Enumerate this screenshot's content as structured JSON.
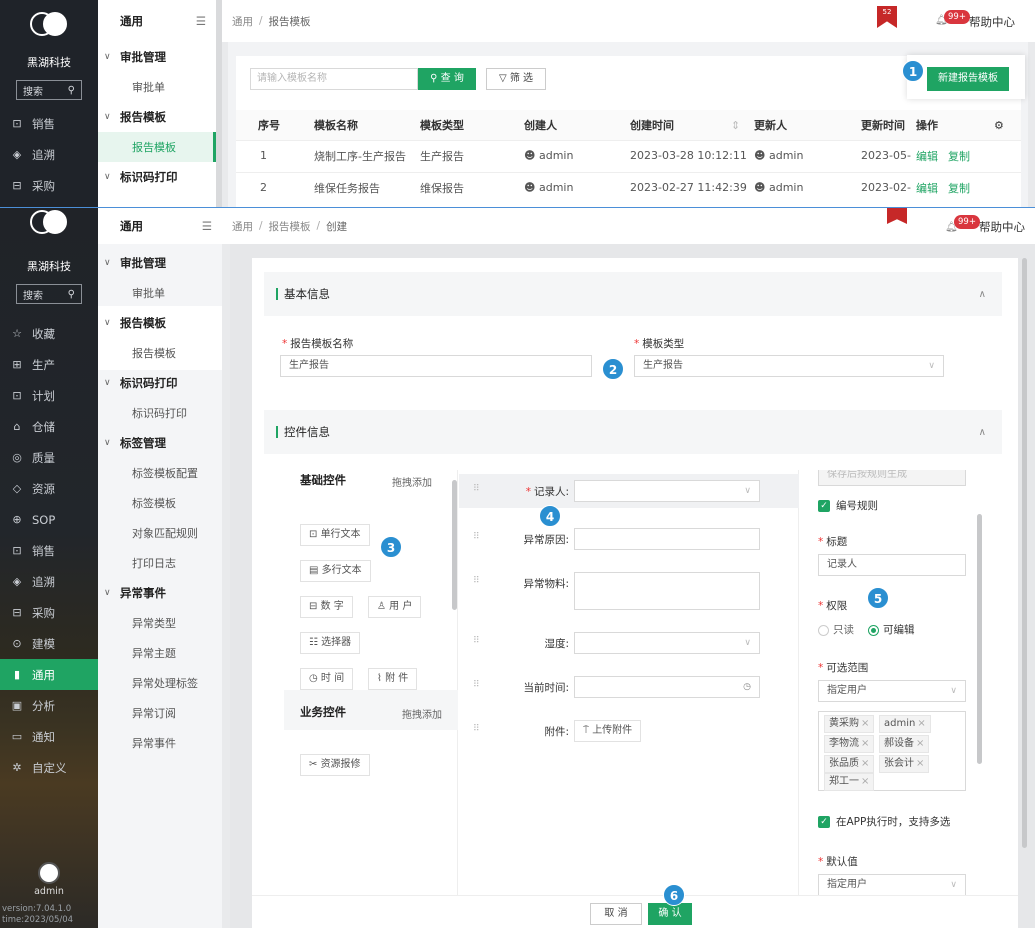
{
  "brand": "黑湖科技",
  "side_search": "搜索",
  "nav_top": [
    {
      "icon": "wallet-icon",
      "glyph": "⊡",
      "label": "销售"
    },
    {
      "icon": "trace-icon",
      "glyph": "◈",
      "label": "追溯"
    },
    {
      "icon": "purchase-icon",
      "glyph": "⊟",
      "label": "采购"
    }
  ],
  "nav_bottom": [
    {
      "icon": "star-icon",
      "glyph": "☆",
      "label": "收藏"
    },
    {
      "icon": "factory-icon",
      "glyph": "⊞",
      "label": "生产"
    },
    {
      "icon": "calendar-icon",
      "glyph": "⊡",
      "label": "计划"
    },
    {
      "icon": "warehouse-icon",
      "glyph": "⌂",
      "label": "仓储"
    },
    {
      "icon": "quality-icon",
      "glyph": "◎",
      "label": "质量"
    },
    {
      "icon": "resource-icon",
      "glyph": "◇",
      "label": "资源"
    },
    {
      "icon": "sop-icon",
      "glyph": "⊕",
      "label": "SOP"
    },
    {
      "icon": "wallet-icon",
      "glyph": "⊡",
      "label": "销售"
    },
    {
      "icon": "trace-icon",
      "glyph": "◈",
      "label": "追溯"
    },
    {
      "icon": "purchase-icon",
      "glyph": "⊟",
      "label": "采购"
    },
    {
      "icon": "model-icon",
      "glyph": "⊙",
      "label": "建模"
    },
    {
      "icon": "doc-icon",
      "glyph": "▮",
      "label": "通用"
    },
    {
      "icon": "analysis-icon",
      "glyph": "▣",
      "label": "分析"
    },
    {
      "icon": "message-icon",
      "glyph": "▭",
      "label": "通知"
    },
    {
      "icon": "custom-icon",
      "glyph": "✲",
      "label": "自定义"
    }
  ],
  "user": "admin",
  "version": "version:7.04.1.0",
  "version_time": "time:2023/05/04",
  "sub_title": "通用",
  "sub_top": {
    "g1": "审批管理",
    "l1": "审批单",
    "g2": "报告模板",
    "l2": "报告模板",
    "g3": "标识码打印"
  },
  "sub_bottom": {
    "g1": "审批管理",
    "l1": "审批单",
    "g2": "报告模板",
    "l2": "报告模板",
    "g3": "标识码打印",
    "l3": "标识码打印",
    "g4": "标签管理",
    "l4a": "标签模板配置",
    "l4b": "标签模板",
    "l4c": "对象匹配规则",
    "l4d": "打印日志",
    "g5": "异常事件",
    "l5a": "异常类型",
    "l5b": "异常主题",
    "l5c": "异常处理标签",
    "l5d": "异常订阅",
    "l5e": "异常事件"
  },
  "topbar": {
    "crumb1": "通用",
    "crumb2": "报告模板",
    "crumb3": "创建",
    "flag_count": "52",
    "notif_badge": "99+",
    "help": "帮助中心"
  },
  "list": {
    "search_placeholder": "请输入模板名称",
    "query_btn": "查 询",
    "filter_btn": "筛 选",
    "new_btn": "新建报告模板",
    "headers": {
      "no": "序号",
      "name": "模板名称",
      "type": "模板类型",
      "creator": "创建人",
      "ctime": "创建时间",
      "updater": "更新人",
      "utime": "更新时间",
      "ops": "操作"
    },
    "rows": [
      {
        "no": "1",
        "name": "烧制工序-生产报告",
        "type": "生产报告",
        "creator": "admin",
        "ctime": "2023-03-28 10:12:11",
        "updater": "admin",
        "utime": "2023-05-",
        "edit": "编辑",
        "copy": "复制"
      },
      {
        "no": "2",
        "name": "维保任务报告",
        "type": "维保报告",
        "creator": "admin",
        "ctime": "2023-02-27 11:42:39",
        "updater": "admin",
        "utime": "2023-02-",
        "edit": "编辑",
        "copy": "复制"
      }
    ]
  },
  "form": {
    "basic_title": "基本信息",
    "name_label": "报告模板名称",
    "name_value": "生产报告",
    "type_label": "模板类型",
    "type_value": "生产报告",
    "control_title": "控件信息"
  },
  "controls": {
    "basic_title": "基础控件",
    "basic_hint": "拖拽添加",
    "items": {
      "single": "单行文本",
      "multi": "多行文本",
      "number": "数 字",
      "user": "用 户",
      "select": "选择器",
      "time": "时 间",
      "attach": "附 件"
    },
    "biz_title": "业务控件",
    "biz_hint": "拖拽添加",
    "biz_item": "资源报修"
  },
  "canvas": {
    "recorder": "记录人",
    "abnormal_reason": "异常原因",
    "abnormal_material": "异常物料",
    "humidity": "湿度",
    "current_time": "当前时间",
    "attachment": "附件",
    "upload_btn": "上传附件"
  },
  "props": {
    "hint_top": "保存后按规则生成",
    "numbering": "编号规则",
    "title_label": "标题",
    "title_value": "记录人",
    "perm_label": "权限",
    "perm_read": "只读",
    "perm_edit": "可编辑",
    "range_label": "可选范围",
    "range_value": "指定用户",
    "tags": [
      "黄采购",
      "admin",
      "李物流",
      "郝设备",
      "张品质",
      "张会计",
      "郑工一"
    ],
    "multi_in_app": "在APP执行时，支持多选",
    "default_label": "默认值",
    "default_value": "指定用户"
  },
  "footer": {
    "cancel": "取 消",
    "confirm": "确 认"
  },
  "markers": [
    "1",
    "2",
    "3",
    "4",
    "5",
    "6"
  ]
}
